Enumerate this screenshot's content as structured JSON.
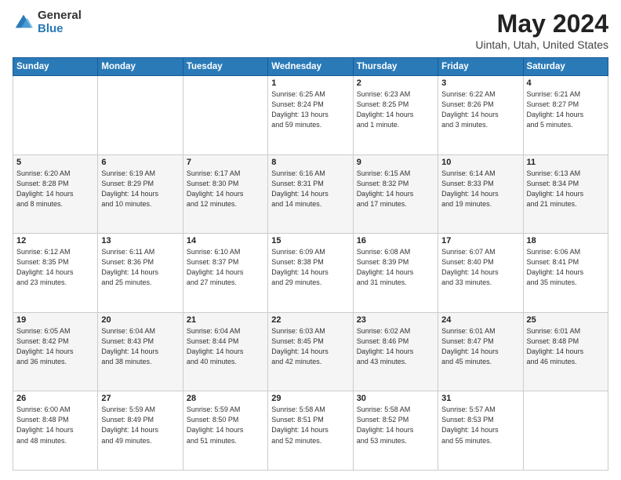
{
  "header": {
    "logo": {
      "general": "General",
      "blue": "Blue"
    },
    "title": "May 2024",
    "location": "Uintah, Utah, United States"
  },
  "days_of_week": [
    "Sunday",
    "Monday",
    "Tuesday",
    "Wednesday",
    "Thursday",
    "Friday",
    "Saturday"
  ],
  "weeks": [
    [
      {
        "day": "",
        "info": ""
      },
      {
        "day": "",
        "info": ""
      },
      {
        "day": "",
        "info": ""
      },
      {
        "day": "1",
        "info": "Sunrise: 6:25 AM\nSunset: 8:24 PM\nDaylight: 13 hours\nand 59 minutes."
      },
      {
        "day": "2",
        "info": "Sunrise: 6:23 AM\nSunset: 8:25 PM\nDaylight: 14 hours\nand 1 minute."
      },
      {
        "day": "3",
        "info": "Sunrise: 6:22 AM\nSunset: 8:26 PM\nDaylight: 14 hours\nand 3 minutes."
      },
      {
        "day": "4",
        "info": "Sunrise: 6:21 AM\nSunset: 8:27 PM\nDaylight: 14 hours\nand 5 minutes."
      }
    ],
    [
      {
        "day": "5",
        "info": "Sunrise: 6:20 AM\nSunset: 8:28 PM\nDaylight: 14 hours\nand 8 minutes."
      },
      {
        "day": "6",
        "info": "Sunrise: 6:19 AM\nSunset: 8:29 PM\nDaylight: 14 hours\nand 10 minutes."
      },
      {
        "day": "7",
        "info": "Sunrise: 6:17 AM\nSunset: 8:30 PM\nDaylight: 14 hours\nand 12 minutes."
      },
      {
        "day": "8",
        "info": "Sunrise: 6:16 AM\nSunset: 8:31 PM\nDaylight: 14 hours\nand 14 minutes."
      },
      {
        "day": "9",
        "info": "Sunrise: 6:15 AM\nSunset: 8:32 PM\nDaylight: 14 hours\nand 17 minutes."
      },
      {
        "day": "10",
        "info": "Sunrise: 6:14 AM\nSunset: 8:33 PM\nDaylight: 14 hours\nand 19 minutes."
      },
      {
        "day": "11",
        "info": "Sunrise: 6:13 AM\nSunset: 8:34 PM\nDaylight: 14 hours\nand 21 minutes."
      }
    ],
    [
      {
        "day": "12",
        "info": "Sunrise: 6:12 AM\nSunset: 8:35 PM\nDaylight: 14 hours\nand 23 minutes."
      },
      {
        "day": "13",
        "info": "Sunrise: 6:11 AM\nSunset: 8:36 PM\nDaylight: 14 hours\nand 25 minutes."
      },
      {
        "day": "14",
        "info": "Sunrise: 6:10 AM\nSunset: 8:37 PM\nDaylight: 14 hours\nand 27 minutes."
      },
      {
        "day": "15",
        "info": "Sunrise: 6:09 AM\nSunset: 8:38 PM\nDaylight: 14 hours\nand 29 minutes."
      },
      {
        "day": "16",
        "info": "Sunrise: 6:08 AM\nSunset: 8:39 PM\nDaylight: 14 hours\nand 31 minutes."
      },
      {
        "day": "17",
        "info": "Sunrise: 6:07 AM\nSunset: 8:40 PM\nDaylight: 14 hours\nand 33 minutes."
      },
      {
        "day": "18",
        "info": "Sunrise: 6:06 AM\nSunset: 8:41 PM\nDaylight: 14 hours\nand 35 minutes."
      }
    ],
    [
      {
        "day": "19",
        "info": "Sunrise: 6:05 AM\nSunset: 8:42 PM\nDaylight: 14 hours\nand 36 minutes."
      },
      {
        "day": "20",
        "info": "Sunrise: 6:04 AM\nSunset: 8:43 PM\nDaylight: 14 hours\nand 38 minutes."
      },
      {
        "day": "21",
        "info": "Sunrise: 6:04 AM\nSunset: 8:44 PM\nDaylight: 14 hours\nand 40 minutes."
      },
      {
        "day": "22",
        "info": "Sunrise: 6:03 AM\nSunset: 8:45 PM\nDaylight: 14 hours\nand 42 minutes."
      },
      {
        "day": "23",
        "info": "Sunrise: 6:02 AM\nSunset: 8:46 PM\nDaylight: 14 hours\nand 43 minutes."
      },
      {
        "day": "24",
        "info": "Sunrise: 6:01 AM\nSunset: 8:47 PM\nDaylight: 14 hours\nand 45 minutes."
      },
      {
        "day": "25",
        "info": "Sunrise: 6:01 AM\nSunset: 8:48 PM\nDaylight: 14 hours\nand 46 minutes."
      }
    ],
    [
      {
        "day": "26",
        "info": "Sunrise: 6:00 AM\nSunset: 8:48 PM\nDaylight: 14 hours\nand 48 minutes."
      },
      {
        "day": "27",
        "info": "Sunrise: 5:59 AM\nSunset: 8:49 PM\nDaylight: 14 hours\nand 49 minutes."
      },
      {
        "day": "28",
        "info": "Sunrise: 5:59 AM\nSunset: 8:50 PM\nDaylight: 14 hours\nand 51 minutes."
      },
      {
        "day": "29",
        "info": "Sunrise: 5:58 AM\nSunset: 8:51 PM\nDaylight: 14 hours\nand 52 minutes."
      },
      {
        "day": "30",
        "info": "Sunrise: 5:58 AM\nSunset: 8:52 PM\nDaylight: 14 hours\nand 53 minutes."
      },
      {
        "day": "31",
        "info": "Sunrise: 5:57 AM\nSunset: 8:53 PM\nDaylight: 14 hours\nand 55 minutes."
      },
      {
        "day": "",
        "info": ""
      }
    ]
  ]
}
